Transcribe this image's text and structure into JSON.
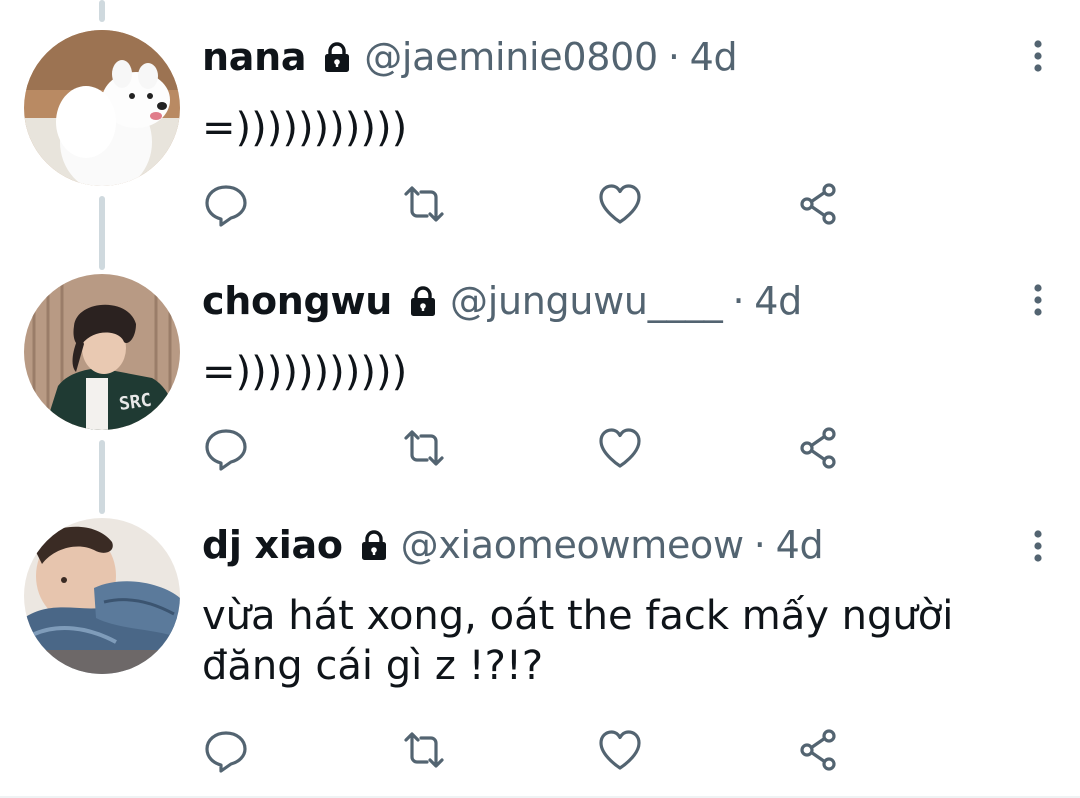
{
  "replies": [
    {
      "display_name": "nana",
      "handle": "@jaeminie0800",
      "separator": "·",
      "time": "4d",
      "text": "=)))))))))))",
      "avatar_icon": "avatar-samoyed-dog-photo",
      "protected_icon": "lock-icon"
    },
    {
      "display_name": "chongwu",
      "handle": "@junguwu____",
      "separator": "·",
      "time": "4d",
      "text": "=)))))))))))",
      "avatar_icon": "avatar-person-jacket-photo",
      "protected_icon": "lock-icon"
    },
    {
      "display_name": "dj xiao",
      "handle": "@xiaomeowmeow",
      "separator": "·",
      "time": "4d",
      "text": "vừa hát xong, oát the fack mấy người đăng cái gì z !?!?",
      "avatar_icon": "avatar-person-denim-photo",
      "protected_icon": "lock-icon"
    }
  ],
  "action_icons": [
    "reply-icon",
    "retweet-icon",
    "like-icon",
    "share-icon"
  ],
  "colors": {
    "text_primary": "#0f1419",
    "text_secondary": "#536471",
    "icon": "#536471",
    "thread_line": "#cfd9de"
  }
}
